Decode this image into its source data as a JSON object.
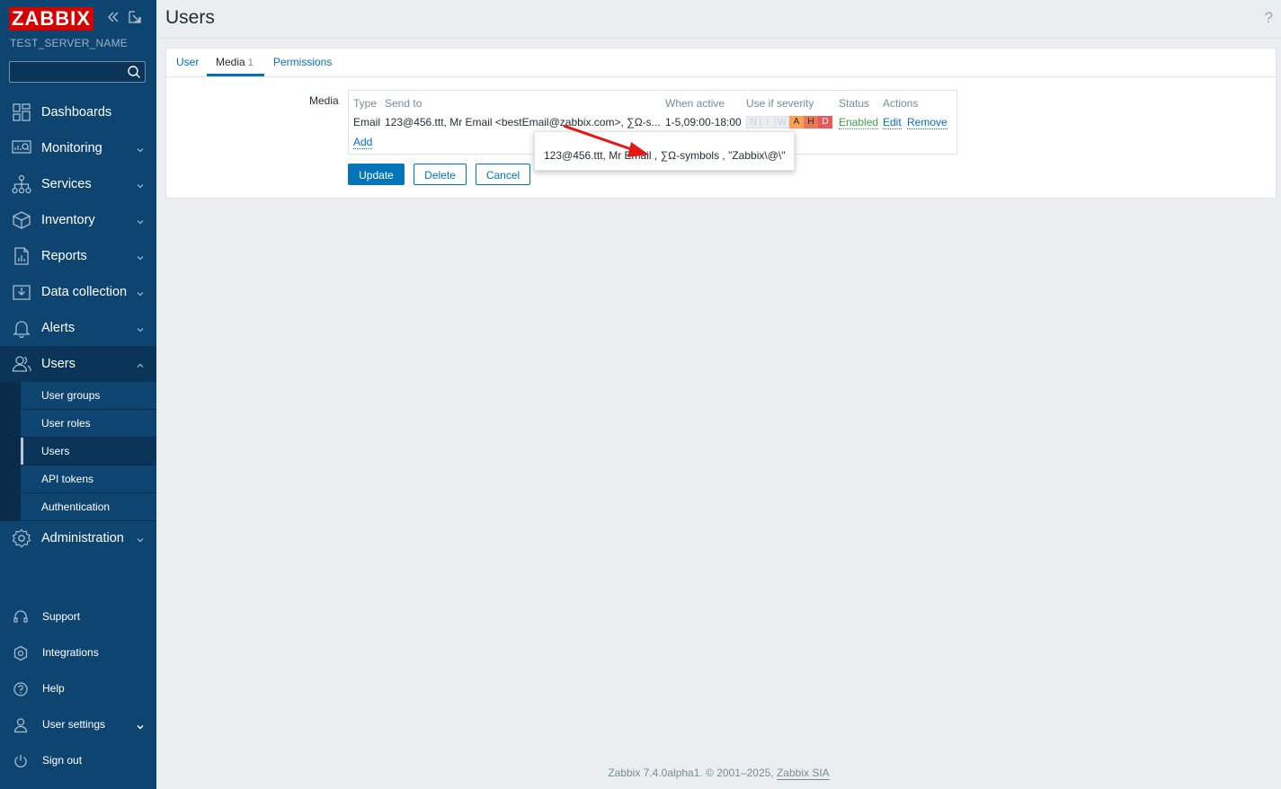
{
  "brand": {
    "logo": "ZABBIX",
    "server_name": "TEST_SERVER_NAME"
  },
  "search": {
    "placeholder": ""
  },
  "nav": {
    "dashboards": "Dashboards",
    "monitoring": "Monitoring",
    "services": "Services",
    "inventory": "Inventory",
    "reports": "Reports",
    "data_collection": "Data collection",
    "alerts": "Alerts",
    "users": "Users",
    "administration": "Administration"
  },
  "users_submenu": {
    "user_groups": "User groups",
    "user_roles": "User roles",
    "users": "Users",
    "api_tokens": "API tokens",
    "authentication": "Authentication"
  },
  "bottom_nav": {
    "support": "Support",
    "integrations": "Integrations",
    "help": "Help",
    "user_settings": "User settings",
    "sign_out": "Sign out"
  },
  "page": {
    "title": "Users",
    "help": "?"
  },
  "tabs": {
    "user": "User",
    "media": "Media",
    "media_count": "1",
    "permissions": "Permissions"
  },
  "form": {
    "media_label": "Media"
  },
  "media_table": {
    "headers": {
      "type": "Type",
      "send_to": "Send to",
      "when_active": "When active",
      "use_if_severity": "Use if severity",
      "status": "Status",
      "actions": "Actions"
    },
    "row": {
      "type": "Email",
      "send_to": "123@456.ttt, Mr Email <bestEmail@zabbix.com>, ∑Ω-s...",
      "when_active": "1-5,09:00-18:00",
      "severity": {
        "n": "N",
        "i": "I",
        "w": "W",
        "a": "A",
        "h": "H",
        "d": "D"
      },
      "status": "Enabled",
      "edit": "Edit",
      "remove": "Remove"
    },
    "add": "Add"
  },
  "buttons": {
    "update": "Update",
    "delete": "Delete",
    "cancel": "Cancel"
  },
  "tooltip": {
    "text": "123@456.ttt, Mr Email , ∑Ω-symbols , \"Zabbix\\@\\\""
  },
  "footer": {
    "text": "Zabbix 7.4.0alpha1. © 2001–2025, ",
    "link": "Zabbix SIA"
  },
  "colors": {
    "sidebar": "#0e4470",
    "accent": "#0275b8",
    "logo": "#d40000",
    "sev_average": "#ffa059",
    "sev_high": "#e97659",
    "sev_disaster": "#e45959",
    "enabled": "#429e47",
    "annotation_arrow": "#e31919"
  }
}
